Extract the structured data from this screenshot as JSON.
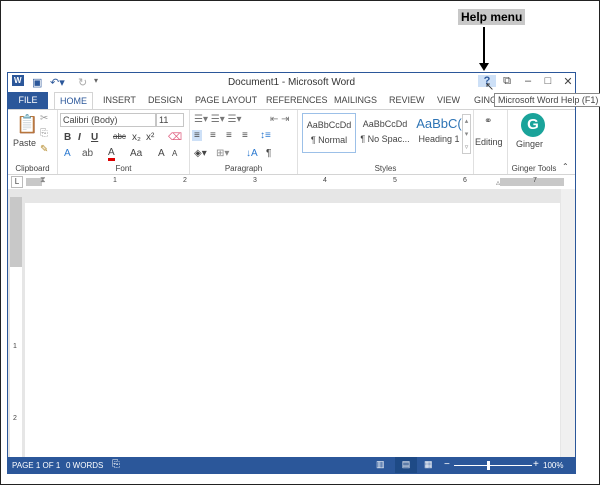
{
  "annotation": {
    "label": "Help menu"
  },
  "window": {
    "title": "Document1 - Microsoft Word",
    "tooltip": "Microsoft Word Help (F1)",
    "help": "?",
    "minimize": "–",
    "maximize": "□",
    "close": "✕",
    "restore_ribbon": "⧉"
  },
  "tabs": [
    {
      "label": "FILE"
    },
    {
      "label": "HOME"
    },
    {
      "label": "INSERT"
    },
    {
      "label": "DESIGN"
    },
    {
      "label": "PAGE LAYOUT"
    },
    {
      "label": "REFERENCES"
    },
    {
      "label": "MAILINGS"
    },
    {
      "label": "REVIEW"
    },
    {
      "label": "VIEW"
    },
    {
      "label": "GING"
    }
  ],
  "ribbon": {
    "clipboard": {
      "label": "Clipboard",
      "paste": "Paste"
    },
    "font": {
      "label": "Font",
      "font_name": "Calibri (Body)",
      "font_size": "11",
      "bold": "B",
      "italic": "I",
      "underline": "U",
      "strike": "abc",
      "sub": "x₂",
      "sup": "x²",
      "color": "A",
      "case": "Aa",
      "grow": "A",
      "shrink": "A"
    },
    "paragraph": {
      "label": "Paragraph",
      "pilcrow": "¶"
    },
    "styles": {
      "label": "Styles",
      "items": [
        {
          "sample": "AaBbCcDd",
          "name": "¶ Normal"
        },
        {
          "sample": "AaBbCcDd",
          "name": "¶ No Spac..."
        },
        {
          "sample": "AaBbC(",
          "name": "Heading 1"
        }
      ]
    },
    "editing": {
      "label": "Editing"
    },
    "ginger": {
      "label": "Ginger Tools",
      "button": "Ginger",
      "logo": "G"
    }
  },
  "ruler": {
    "tab": "L",
    "marks": [
      "1",
      "2",
      "3",
      "4",
      "5",
      "6",
      "7"
    ],
    "vmarks": [
      "1",
      "2"
    ]
  },
  "status": {
    "page": "PAGE 1 OF 1",
    "words": "0 WORDS",
    "zoom": "100%",
    "zoom_level_percent": 100
  },
  "colors": {
    "accent": "#2b579a",
    "ginger": "#1aa39a"
  }
}
